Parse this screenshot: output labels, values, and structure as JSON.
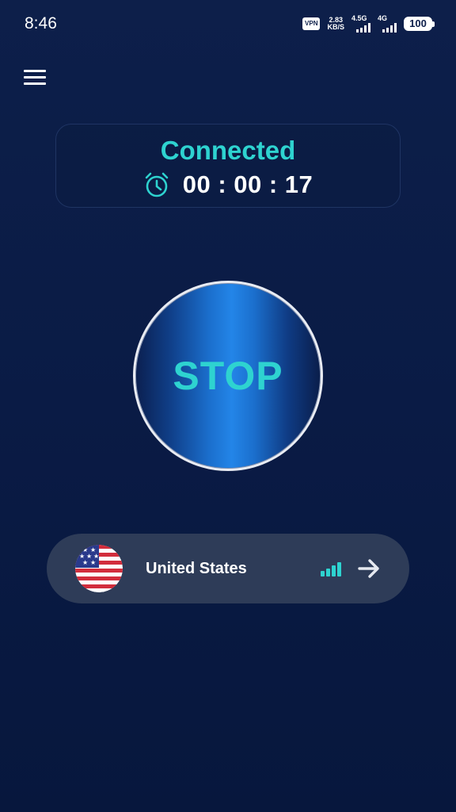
{
  "status_bar": {
    "time": "8:46",
    "vpn_badge": "VPN",
    "speed_value": "2.83",
    "speed_unit": "KB/S",
    "network_1": "4.5G",
    "network_2": "4G",
    "battery": "100"
  },
  "menu": {
    "icon": "hamburger-menu-icon"
  },
  "connection": {
    "status": "Connected",
    "timer": "00 : 00 : 17",
    "timer_icon": "alarm-clock-icon"
  },
  "action_button": {
    "label": "STOP"
  },
  "server": {
    "country": "United States",
    "flag_icon": "us-flag-icon",
    "signal_icon": "signal-strength-icon",
    "arrow_icon": "arrow-right-icon"
  },
  "colors": {
    "accent": "#2ed3d0",
    "background": "#0a1b45",
    "pill": "#2e3c58"
  }
}
